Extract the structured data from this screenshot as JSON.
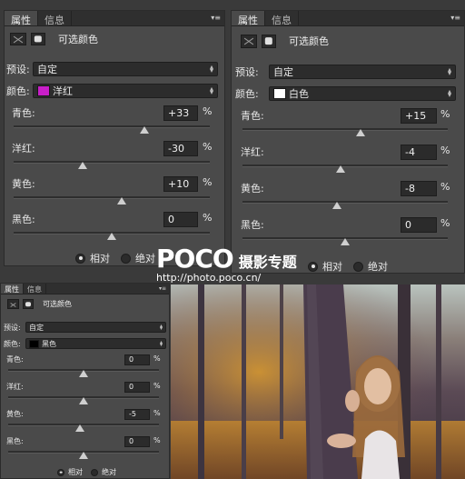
{
  "panel_tabs": {
    "properties": "属性",
    "info": "信息"
  },
  "header_title": "可选颜色",
  "preset": {
    "label": "预设:",
    "value": "自定"
  },
  "color_label": "颜色:",
  "percent": "%",
  "radio": {
    "relative": "相对",
    "absolute": "绝对"
  },
  "panels": [
    {
      "color": {
        "name": "洋红",
        "swatch": "#c81ec8"
      },
      "sliders": [
        {
          "name": "青色:",
          "value": "+33",
          "fraction": 0.665
        },
        {
          "name": "洋红:",
          "value": "-30",
          "fraction": 0.35
        },
        {
          "name": "黄色:",
          "value": "+10",
          "fraction": 0.55
        },
        {
          "name": "黑色:",
          "value": "0",
          "fraction": 0.5
        }
      ]
    },
    {
      "color": {
        "name": "白色",
        "swatch": "#ffffff"
      },
      "sliders": [
        {
          "name": "青色:",
          "value": "+15",
          "fraction": 0.575
        },
        {
          "name": "洋红:",
          "value": "-4",
          "fraction": 0.48
        },
        {
          "name": "黄色:",
          "value": "-8",
          "fraction": 0.46
        },
        {
          "name": "黑色:",
          "value": "0",
          "fraction": 0.5
        }
      ]
    },
    {
      "color": {
        "name": "黑色",
        "swatch": "#000000"
      },
      "sliders": [
        {
          "name": "青色:",
          "value": "0",
          "fraction": 0.5
        },
        {
          "name": "洋红:",
          "value": "0",
          "fraction": 0.5
        },
        {
          "name": "黄色:",
          "value": "-5",
          "fraction": 0.475
        },
        {
          "name": "黑色:",
          "value": "0",
          "fraction": 0.5
        }
      ]
    }
  ],
  "watermark": {
    "brand": "POCO",
    "subtitle": "摄影专题",
    "url": "http://photo.poco.cn/"
  }
}
